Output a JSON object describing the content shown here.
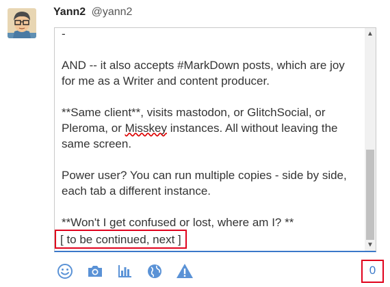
{
  "user": {
    "display_name": "Yann2",
    "handle": "@yann2"
  },
  "editor": {
    "lines": [
      "-",
      "",
      "AND -- it also accepts #MarkDown posts, which are joy",
      "for me as a Writer and content producer.",
      "",
      "**Same client**, visits mastodon, or GlitchSocial, or",
      [
        "Pleroma, or ",
        "Misskey",
        " instances. All without leaving the"
      ],
      "same screen.",
      "",
      "Power user? You can run multiple copies - side by side,",
      "each tab a different instance.",
      "",
      "**Won't I get confused or lost, where am I? **"
    ],
    "continued": "[ to be continued, next ]"
  },
  "toolbar": {
    "icons": [
      "smiley-icon",
      "camera-icon",
      "poll-icon",
      "globe-icon",
      "warning-icon"
    ],
    "counter": "0"
  },
  "colors": {
    "accent": "#3a78c9",
    "highlight": "#e0001b",
    "icon": "#5a92d6"
  }
}
